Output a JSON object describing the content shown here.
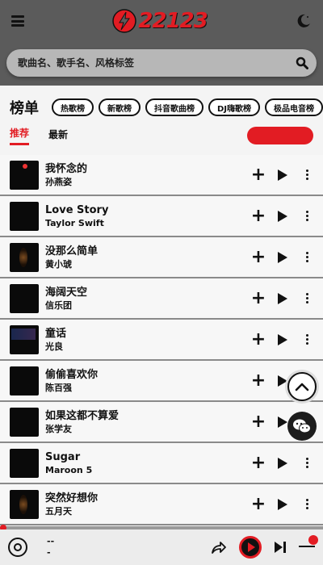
{
  "header": {
    "logo_text": "22123",
    "brand_color": "#e21c23",
    "icons": {
      "menu": "menu-icon",
      "logo": "lightning-icon",
      "theme": "moon-icon"
    }
  },
  "search": {
    "placeholder": "歌曲名、歌手名、风格标签"
  },
  "section": {
    "title": "榜单",
    "chips": [
      "热歌榜",
      "新歌榜",
      "抖音歌曲榜",
      "DJ嗨歌榜",
      "极品电音榜"
    ]
  },
  "tabs": [
    {
      "label": "推荐",
      "active": true
    },
    {
      "label": "最新",
      "active": false
    }
  ],
  "play_all_label": "",
  "songs": [
    {
      "title": "我怀念的",
      "artist": "孙燕姿",
      "cover": "person dot"
    },
    {
      "title": "Love Story",
      "artist": "Taylor Swift",
      "cover": ""
    },
    {
      "title": "没那么简单",
      "artist": "黄小琥",
      "cover": "warm"
    },
    {
      "title": "海阔天空",
      "artist": "信乐团",
      "cover": ""
    },
    {
      "title": "童话",
      "artist": "光良",
      "cover": "blue"
    },
    {
      "title": "偷偷喜欢你",
      "artist": "陈百强",
      "cover": ""
    },
    {
      "title": "如果这都不算爱",
      "artist": "张学友",
      "cover": ""
    },
    {
      "title": "Sugar",
      "artist": "Maroon 5",
      "cover": ""
    },
    {
      "title": "突然好想你",
      "artist": "五月天",
      "cover": "warm"
    }
  ],
  "player": {
    "title": "--",
    "artist": "-",
    "progress": 0
  }
}
